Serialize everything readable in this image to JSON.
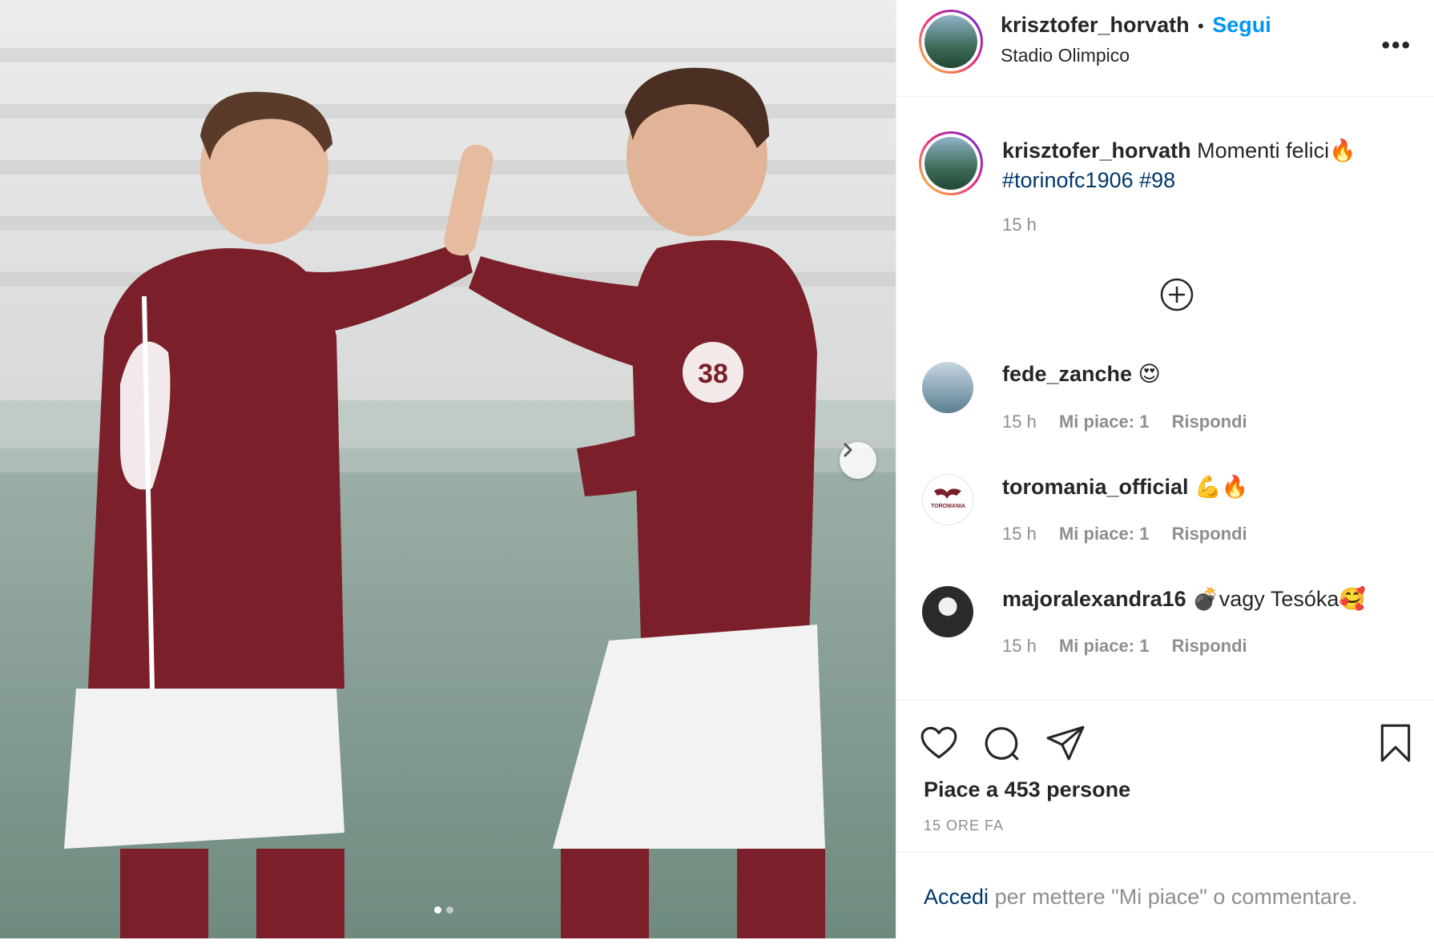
{
  "post": {
    "author": "krisztofer_horvath",
    "follow_label": "Segui",
    "separator": "•",
    "location": "Stadio Olimpico",
    "more_label": "•••",
    "caption": {
      "username": "krisztofer_horvath",
      "text": "Momenti felici🔥",
      "hashtags": [
        "#torinofc1906",
        "#98"
      ],
      "time": "15 h"
    },
    "comments": [
      {
        "username": "fede_zanche",
        "text": "😍",
        "time": "15 h",
        "likes": "Mi piace: 1",
        "reply": "Rispondi"
      },
      {
        "username": "toromania_official",
        "text": "💪🔥",
        "time": "15 h",
        "likes": "Mi piace: 1",
        "reply": "Rispondi"
      },
      {
        "username": "majoralexandra16",
        "text": "💣vagy Tesóka🥰",
        "time": "15 h",
        "likes": "Mi piace: 1",
        "reply": "Rispondi"
      }
    ],
    "likes_text": "Piace a 453 persone",
    "posted_ago": "15 ORE FA",
    "login_prompt": {
      "link": "Accedi",
      "rest": "per mettere \"Mi piace\" o commentare."
    },
    "toromania_logo_text": "TOROMANIA"
  },
  "colors": {
    "link_blue": "#0095f6",
    "hashtag_blue": "#00376b",
    "jersey": "#7b1f2a",
    "secondary_text": "#8e8e8e"
  },
  "icons": [
    "heart-icon",
    "comment-icon",
    "share-icon",
    "bookmark-icon",
    "add-circle-icon",
    "chevron-right-icon"
  ],
  "media": {
    "current_slide": 1,
    "total_slides": 2
  }
}
